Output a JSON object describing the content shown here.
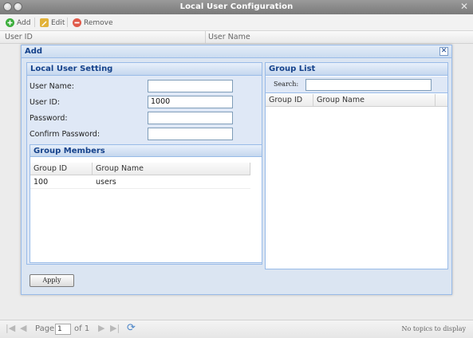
{
  "window": {
    "title": "Local User Configuration",
    "close_glyph": "✕"
  },
  "toolbar": {
    "add_label": "Add",
    "edit_label": "Edit",
    "remove_label": "Remove",
    "colors": {
      "add": "#3cae3c",
      "edit": "#e2b23a",
      "remove": "#e05a4a"
    }
  },
  "user_grid": {
    "columns": [
      "User ID",
      "User Name"
    ]
  },
  "pager": {
    "page_label": "Page",
    "page_value": "1",
    "of_label": "of 1",
    "empty_message": "No topics to display",
    "icons": [
      "first-page-icon",
      "prev-page-icon",
      "next-page-icon",
      "last-page-icon",
      "refresh-icon"
    ]
  },
  "dialog": {
    "title": "Add",
    "close_glyph": "✕",
    "local_user_setting": {
      "title": "Local User Setting",
      "fields": [
        {
          "label": "User Name:",
          "value": ""
        },
        {
          "label": "User ID:",
          "value": "1000"
        },
        {
          "label": "Password:",
          "value": ""
        },
        {
          "label": "Confirm Password:",
          "value": ""
        }
      ]
    },
    "group_members": {
      "title": "Group Members",
      "columns": [
        "Group ID",
        "Group Name"
      ],
      "rows": [
        {
          "group_id": "100",
          "group_name": "users"
        }
      ]
    },
    "group_list": {
      "title": "Group List",
      "search_label": "Search:",
      "search_value": "",
      "columns": [
        "Group ID",
        "Group Name"
      ],
      "rows": []
    },
    "apply_label": "Apply"
  },
  "colors": {
    "accent_title": "#15428b",
    "panel_border": "#99bbe8",
    "dialog_bg": "#dbe5f2"
  }
}
